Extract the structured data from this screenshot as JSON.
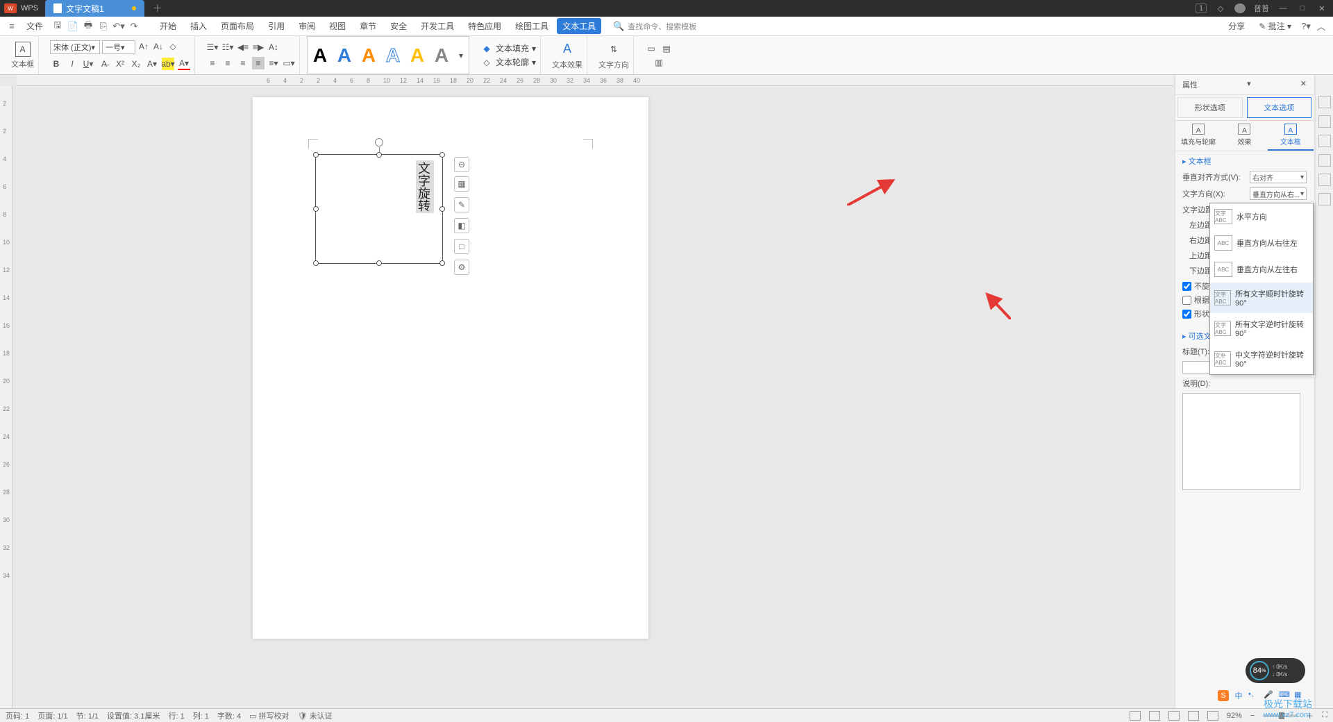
{
  "titlebar": {
    "app": "WPS",
    "doc": "文字文稿1",
    "tray_num": "1",
    "user": "普普"
  },
  "menus": {
    "file": "文件",
    "items": [
      "开始",
      "插入",
      "页面布局",
      "引用",
      "审阅",
      "视图",
      "章节",
      "安全",
      "开发工具",
      "特色应用",
      "绘图工具",
      "文本工具"
    ],
    "active_index": 11,
    "search_label": "查找命令、搜索模板",
    "share": "分享",
    "annotate": "批注"
  },
  "ribbon": {
    "textbox_label": "文本框",
    "font_name": "宋体 (正文)",
    "font_size": "一号",
    "fill": "文本填充",
    "outline": "文本轮廓",
    "effect": "文本效果",
    "direction": "文字方向"
  },
  "ruler_h": [
    "6",
    "4",
    "2",
    "2",
    "4",
    "6",
    "8",
    "10",
    "12",
    "14",
    "16",
    "18",
    "20",
    "22",
    "24",
    "26",
    "28",
    "30",
    "32",
    "34",
    "36",
    "38",
    "40"
  ],
  "ruler_v": [
    "2",
    "2",
    "4",
    "6",
    "8",
    "10",
    "12",
    "14",
    "16",
    "18",
    "20",
    "22",
    "24",
    "26",
    "28",
    "30",
    "32",
    "34"
  ],
  "textbox_content": "文字旋转",
  "panel": {
    "title": "属性",
    "tab_shape": "形状选项",
    "tab_text": "文本选项",
    "sub_fill": "填充与轮廓",
    "sub_effect": "效果",
    "sub_textbox": "文本框",
    "sec_textbox": "文本框",
    "valign_label": "垂直对齐方式(V):",
    "valign_value": "右对齐",
    "dir_label": "文字方向(X):",
    "dir_value": "垂直方向从右...",
    "margin_label": "文字边距(E):",
    "ml": "左边距(L)",
    "mr": "右边距(R)",
    "mt": "上边距(T)",
    "mb": "下边距(B)",
    "chk1": "不旋转文",
    "chk2": "根据文字",
    "chk3": "形状中的",
    "sec_alt": "可选文字",
    "title_label": "标题(T):",
    "desc_label": "说明(D):"
  },
  "dropdown": {
    "options": [
      {
        "icon": "文字\nABC",
        "label": "水平方向"
      },
      {
        "icon": "ABC",
        "label": "垂直方向从右往左"
      },
      {
        "icon": "ABC",
        "label": "垂直方向从左往右"
      },
      {
        "icon": "文字\nABC",
        "label": "所有文字顺时针旋转90°",
        "hover": true
      },
      {
        "icon": "文字\nABC",
        "label": "所有文字逆时针旋转90°"
      },
      {
        "icon": "文朴\nABC",
        "label": "中文字符逆时针旋转90°"
      }
    ]
  },
  "status": {
    "page_label": "页码: 1",
    "pages": "页面: 1/1",
    "section": "节: 1/1",
    "setting": "设置值: 3.1厘米",
    "line": "行: 1",
    "col": "列: 1",
    "words": "字数: 4",
    "spell": "拼写校对",
    "auth": "未认证",
    "zoom": "92%"
  },
  "gauge": {
    "pct": "84",
    "unit": "%",
    "net": "0K/s"
  },
  "ime": {
    "s": "S",
    "zh": "中"
  },
  "watermark": {
    "site": "极光下载站",
    "url": "www.xz7.com"
  }
}
